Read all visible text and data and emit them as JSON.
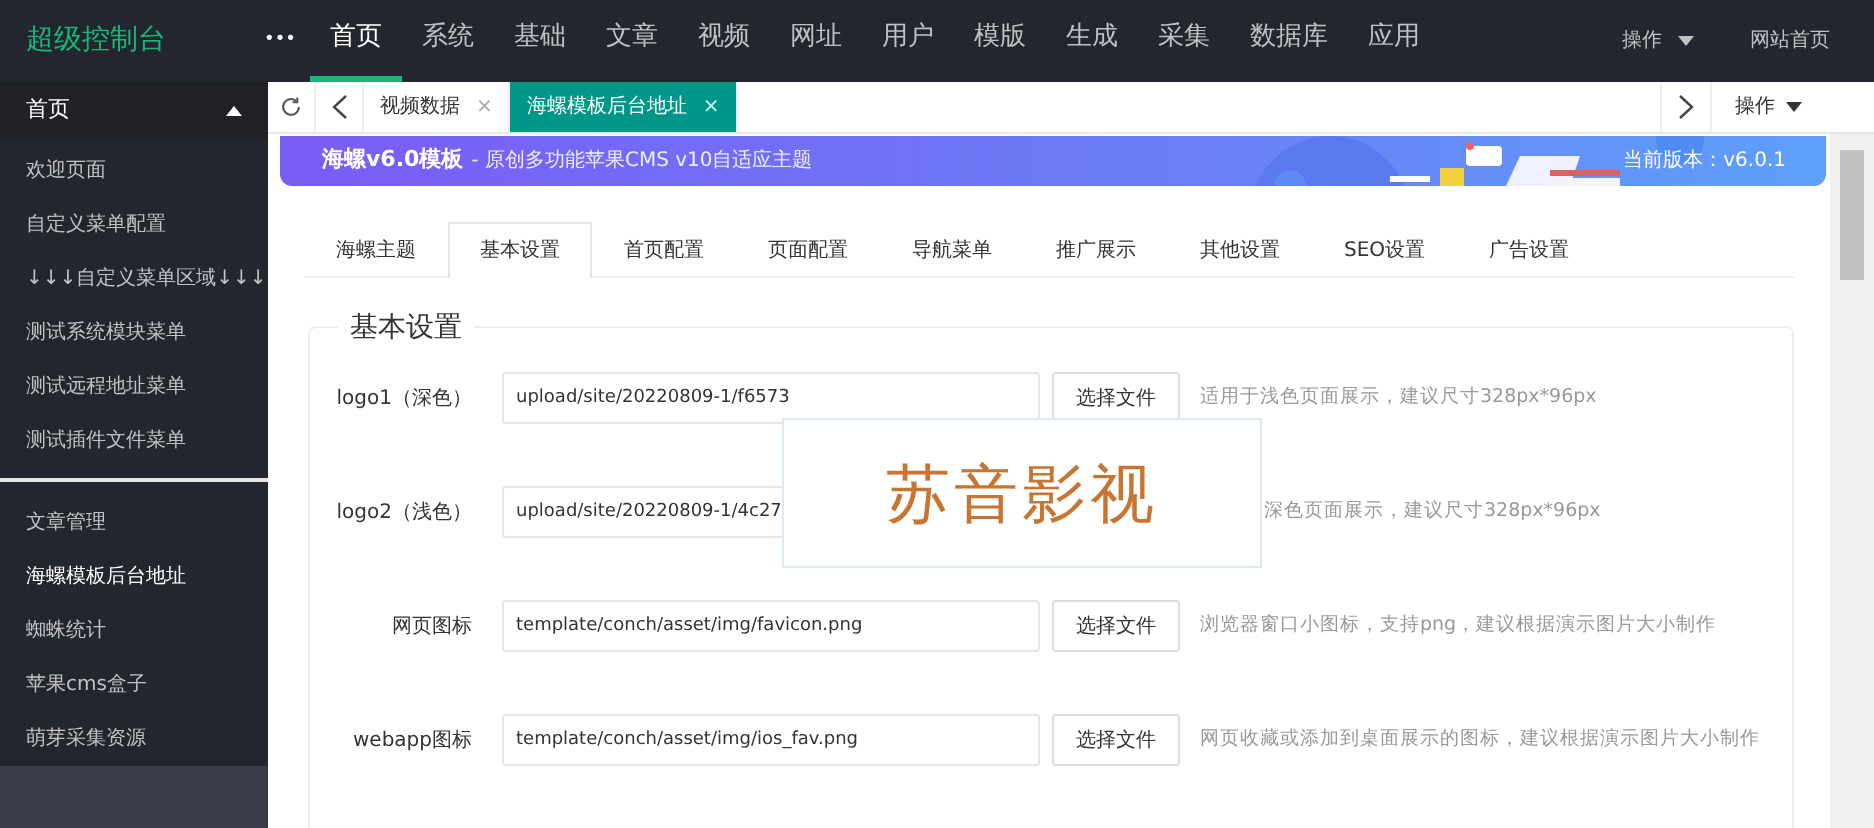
{
  "app_title": "超级控制台",
  "more": "•••",
  "nav": [
    {
      "label": "首页",
      "selected": true
    },
    {
      "label": "系统",
      "selected": false
    },
    {
      "label": "基础",
      "selected": false
    },
    {
      "label": "文章",
      "selected": false
    },
    {
      "label": "视频",
      "selected": false
    },
    {
      "label": "网址",
      "selected": false
    },
    {
      "label": "用户",
      "selected": false
    },
    {
      "label": "模版",
      "selected": false
    },
    {
      "label": "生成",
      "selected": false
    },
    {
      "label": "采集",
      "selected": false
    },
    {
      "label": "数据库",
      "selected": false
    },
    {
      "label": "应用",
      "selected": false
    }
  ],
  "nav_right": [
    {
      "label": "操作",
      "kind": "dropdown"
    },
    {
      "label": "网站首页",
      "kind": "link"
    }
  ],
  "sidebar": {
    "header": {
      "label": "首页",
      "expanded": true
    },
    "groups": [
      [
        {
          "label": "欢迎页面",
          "selected": false
        },
        {
          "label": "自定义菜单配置",
          "selected": false
        },
        {
          "label": "↓↓↓自定义菜单区域↓↓↓",
          "selected": false
        },
        {
          "label": "测试系统模块菜单",
          "selected": false
        },
        {
          "label": "测试远程地址菜单",
          "selected": false
        },
        {
          "label": "测试插件文件菜单",
          "selected": false
        }
      ],
      [
        {
          "label": "文章管理",
          "selected": false
        },
        {
          "label": "海螺模板后台地址",
          "selected": true
        },
        {
          "label": "蜘蛛统计",
          "selected": false
        },
        {
          "label": "苹果cms盒子",
          "selected": false
        },
        {
          "label": "萌芽采集资源",
          "selected": false
        }
      ]
    ]
  },
  "tabs": [
    {
      "label": "视频数据",
      "close": "×",
      "selected": false
    },
    {
      "label": "海螺模板后台地址",
      "close": "×",
      "selected": true
    }
  ],
  "tab_actions": "操作",
  "banner": {
    "title": "海螺v6.0模板",
    "subtitle": "- 原创多功能苹果CMS v10自适应主题",
    "version": "当前版本：v6.0.1"
  },
  "settings_tabs": [
    {
      "label": "海螺主题",
      "selected": false
    },
    {
      "label": "基本设置",
      "selected": true
    },
    {
      "label": "首页配置",
      "selected": false
    },
    {
      "label": "页面配置",
      "selected": false
    },
    {
      "label": "导航菜单",
      "selected": false
    },
    {
      "label": "推广展示",
      "selected": false
    },
    {
      "label": "其他设置",
      "selected": false
    },
    {
      "label": "SEO设置",
      "selected": false
    },
    {
      "label": "广告设置",
      "selected": false
    }
  ],
  "fieldset": {
    "legend": "基本设置",
    "rows": [
      {
        "label": "logo1（深色）",
        "value": "upload/site/20220809-1/f6573",
        "button": "选择文件",
        "hint": "适用于浅色页面展示，建议尺寸328px*96px"
      },
      {
        "label": "logo2（浅色）",
        "value": "upload/site/20220809-1/4c27",
        "hint": "深色页面展示，建议尺寸328px*96px"
      },
      {
        "label": "网页图标",
        "value": "template/conch/asset/img/favicon.png",
        "button": "选择文件",
        "hint": "浏览器窗口小图标，支持png，建议根据演示图片大小制作"
      },
      {
        "label": "webapp图标",
        "value": "template/conch/asset/img/ios_fav.png",
        "button": "选择文件",
        "hint": "网页收藏或添加到桌面展示的图标，建议根据演示图片大小制作"
      }
    ]
  },
  "preview": {
    "text": "苏音影视"
  }
}
